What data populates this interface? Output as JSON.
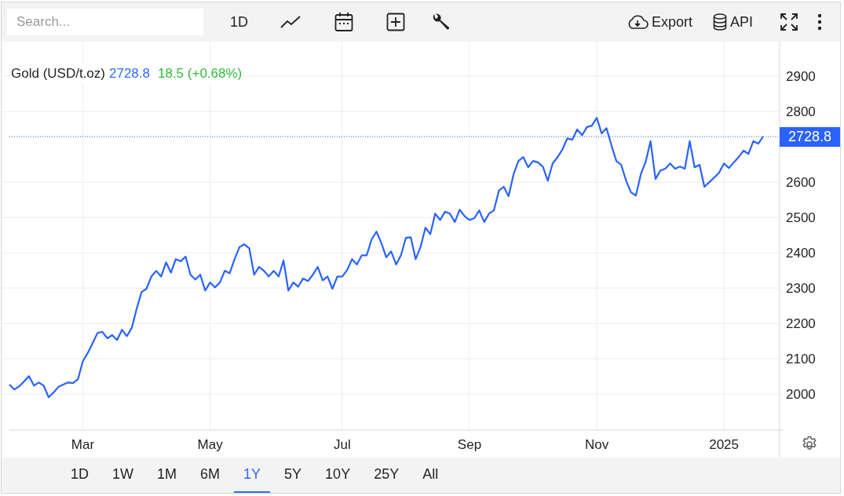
{
  "toolbar": {
    "search": {
      "placeholder": "Search..."
    },
    "interval": "1D",
    "export_label": "Export",
    "api_label": "API"
  },
  "legend": {
    "price": "2728.8",
    "change": "18.5 (+0.68%)"
  },
  "price_label": "2728.8",
  "chart_data": {
    "type": "line",
    "grid": true,
    "ref_lines": [
      {
        "axis": "y",
        "value": 2729,
        "color": "#2962ff"
      }
    ],
    "ylim": [
      1898,
      2998
    ],
    "yticks": [
      2000,
      2100,
      2200,
      2300,
      2400,
      2500,
      2600,
      2800,
      2900
    ],
    "categories": [
      null,
      null,
      null,
      null,
      null,
      null,
      null,
      null,
      null,
      null,
      null,
      null,
      null,
      null,
      null,
      "Mar",
      null,
      null,
      null,
      null,
      null,
      null,
      null,
      null,
      null,
      null,
      null,
      null,
      null,
      null,
      null,
      null,
      null,
      null,
      null,
      null,
      null,
      null,
      null,
      null,
      null,
      "May",
      null,
      null,
      null,
      null,
      null,
      null,
      null,
      null,
      null,
      null,
      null,
      null,
      null,
      null,
      null,
      null,
      null,
      null,
      null,
      null,
      null,
      null,
      null,
      null,
      null,
      null,
      "Jul",
      null,
      null,
      null,
      null,
      null,
      null,
      null,
      null,
      null,
      null,
      null,
      null,
      null,
      null,
      null,
      null,
      null,
      null,
      null,
      null,
      null,
      null,
      null,
      null,
      null,
      "Sep",
      null,
      null,
      null,
      null,
      null,
      null,
      null,
      null,
      null,
      null,
      null,
      null,
      null,
      null,
      null,
      null,
      null,
      null,
      null,
      null,
      null,
      null,
      null,
      null,
      null,
      "Nov",
      null,
      null,
      null,
      null,
      null,
      null,
      null,
      null,
      null,
      null,
      null,
      null,
      null,
      null,
      null,
      null,
      null,
      null,
      null,
      null,
      null,
      null,
      null,
      null,
      null,
      "2025",
      null,
      null,
      null,
      null,
      null,
      null,
      null,
      null
    ],
    "series": [
      {
        "name": "Gold (USD/t.oz)",
        "color": "#2962ff",
        "values": [
          2027,
          2013,
          2022,
          2036,
          2051,
          2024,
          2033,
          2024,
          1991,
          2004,
          2020,
          2027,
          2033,
          2031,
          2042,
          2093,
          2116,
          2144,
          2173,
          2176,
          2158,
          2167,
          2153,
          2182,
          2164,
          2187,
          2242,
          2289,
          2298,
          2333,
          2349,
          2333,
          2373,
          2344,
          2382,
          2376,
          2389,
          2338,
          2324,
          2338,
          2293,
          2316,
          2302,
          2316,
          2349,
          2342,
          2382,
          2416,
          2424,
          2413,
          2338,
          2360,
          2349,
          2333,
          2349,
          2333,
          2378,
          2293,
          2316,
          2304,
          2327,
          2320,
          2338,
          2360,
          2322,
          2333,
          2298,
          2333,
          2333,
          2351,
          2382,
          2367,
          2393,
          2393,
          2438,
          2460,
          2427,
          2387,
          2404,
          2367,
          2393,
          2442,
          2444,
          2382,
          2416,
          2471,
          2453,
          2511,
          2493,
          2516,
          2511,
          2487,
          2522,
          2504,
          2493,
          2498,
          2520,
          2487,
          2511,
          2520,
          2576,
          2587,
          2560,
          2622,
          2660,
          2671,
          2642,
          2660,
          2656,
          2644,
          2604,
          2653,
          2671,
          2693,
          2724,
          2720,
          2749,
          2733,
          2756,
          2760,
          2782,
          2738,
          2753,
          2704,
          2660,
          2649,
          2604,
          2571,
          2562,
          2622,
          2658,
          2716,
          2609,
          2633,
          2638,
          2653,
          2638,
          2644,
          2638,
          2716,
          2642,
          2649,
          2587,
          2600,
          2613,
          2627,
          2653,
          2640,
          2656,
          2671,
          2689,
          2680,
          2716,
          2709,
          2729
        ]
      }
    ]
  },
  "ranges": [
    {
      "label": "1D",
      "selected": false
    },
    {
      "label": "1W",
      "selected": false
    },
    {
      "label": "1M",
      "selected": false
    },
    {
      "label": "6M",
      "selected": false
    },
    {
      "label": "1Y",
      "selected": true
    },
    {
      "label": "5Y",
      "selected": false
    },
    {
      "label": "10Y",
      "selected": false
    },
    {
      "label": "25Y",
      "selected": false
    },
    {
      "label": "All",
      "selected": false
    }
  ]
}
